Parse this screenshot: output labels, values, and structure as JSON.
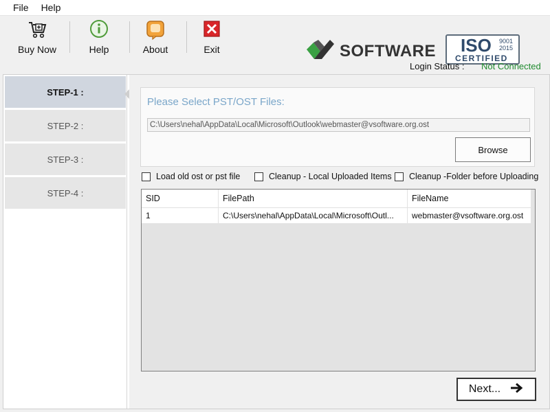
{
  "menu": {
    "items": [
      "File",
      "Help"
    ]
  },
  "toolbar": {
    "buttons": [
      {
        "label": "Buy Now",
        "icon": "cart-icon"
      },
      {
        "label": "Help",
        "icon": "info-icon"
      },
      {
        "label": "About",
        "icon": "about-icon"
      },
      {
        "label": "Exit",
        "icon": "exit-icon"
      }
    ]
  },
  "brand": {
    "name": "SOFTWARE",
    "iso_big": "ISO",
    "iso_year1": "9001",
    "iso_year2": "2015",
    "iso_certified": "CERTIFIED"
  },
  "login": {
    "label": "Login Status :",
    "value": "Not Connected",
    "value_color": "#1f8a2e"
  },
  "steps": [
    "STEP-1 :",
    "STEP-2 :",
    "STEP-3 :",
    "STEP-4 :"
  ],
  "select": {
    "title": "Please Select PST/OST Files:",
    "path": "C:\\Users\\nehal\\AppData\\Local\\Microsoft\\Outlook\\webmaster@vsoftware.org.ost",
    "browse_label": "Browse"
  },
  "options": [
    {
      "label": "Load old ost or pst file",
      "checked": false
    },
    {
      "label": "Cleanup - Local Uploaded Items",
      "checked": false
    },
    {
      "label": "Cleanup -Folder before Uploading",
      "checked": false
    }
  ],
  "table": {
    "columns": [
      "SID",
      "FilePath",
      "FileName"
    ],
    "rows": [
      [
        "1",
        "C:\\Users\\nehal\\AppData\\Local\\Microsoft\\Outl...",
        "webmaster@vsoftware.org.ost"
      ]
    ]
  },
  "next_label": "Next...",
  "colors": {
    "accent_title": "#7aa6c9",
    "status_green": "#1f8a2e",
    "logo_green": "#3aa043"
  }
}
